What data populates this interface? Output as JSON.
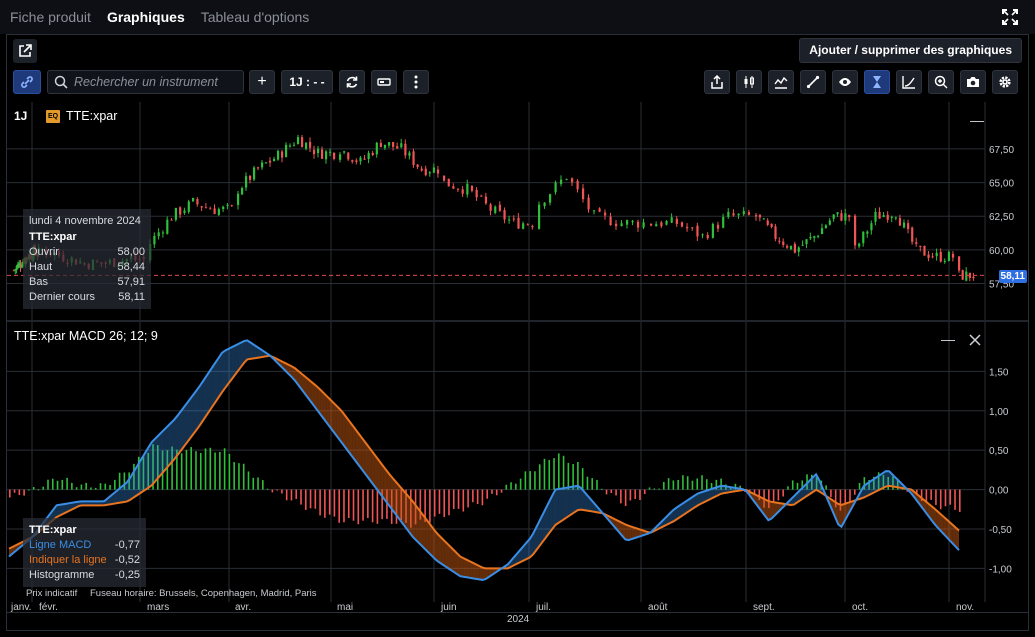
{
  "tabs": [
    {
      "label": "Fiche produit",
      "active": false
    },
    {
      "label": "Graphiques",
      "active": true
    },
    {
      "label": "Tableau d'options",
      "active": false
    }
  ],
  "header": {
    "add_remove_label": "Ajouter / supprimer des graphiques"
  },
  "toolbar": {
    "search_placeholder": "Rechercher un instrument",
    "add_label": "+",
    "interval_label": "1J : - -",
    "icons": [
      "link-icon",
      "search-icon",
      "refresh-icon",
      "chart-type-icon",
      "more-vertical-icon",
      "share-icon",
      "candles-icon",
      "indicators-icon",
      "draw-line-icon",
      "eye-icon",
      "crosshair-icon",
      "compare-icon",
      "zoom-icon",
      "camera-icon",
      "gear-icon"
    ]
  },
  "price_pane": {
    "interval": "1J",
    "badge": "EQ",
    "symbol": "TTE:xpar",
    "y_ticks": [
      "67,50",
      "65,00",
      "62,50",
      "60,00",
      "57,50"
    ],
    "last_price_tag": "58,11",
    "tooltip": {
      "date": "lundi 4 novembre 2024",
      "symbol": "TTE:xpar",
      "rows": [
        {
          "label": "Ouvrir",
          "value": "58,00"
        },
        {
          "label": "Haut",
          "value": "58,44"
        },
        {
          "label": "Bas",
          "value": "57,91"
        },
        {
          "label": "Dernier cours",
          "value": "58,11"
        }
      ]
    }
  },
  "macd_pane": {
    "title": "TTE:xpar  MACD 26; 12; 9",
    "y_ticks": [
      "1,50",
      "1,00",
      "0,50",
      "0,00",
      "-0,50",
      "-1,00"
    ],
    "tooltip": {
      "symbol": "TTE:xpar",
      "rows": [
        {
          "label": "Ligne MACD",
          "value": "-0,77",
          "color": "#3a8ee6"
        },
        {
          "label": "Indiquer la ligne",
          "value": "-0,52",
          "color": "#e8741f"
        },
        {
          "label": "Histogramme",
          "value": "-0,25",
          "color": "#d8dbe0"
        }
      ]
    },
    "colors": {
      "macd": "#3a8ee6",
      "signal": "#e8741f",
      "hist_up": "#2fbf3a",
      "hist_down": "#f05454"
    }
  },
  "x_axis": {
    "months": [
      "janv.",
      "févr.",
      "mars",
      "avr.",
      "mai",
      "juin",
      "juil.",
      "août",
      "sept.",
      "oct.",
      "nov."
    ],
    "year": "2024"
  },
  "footnote": {
    "indicative": "Prix indicatif",
    "timezone": "Fuseau horaire: Brussels, Copenhagen, Madrid, Paris"
  },
  "chart_data": [
    {
      "type": "candlestick",
      "series_name": "TTE:xpar",
      "ylim": [
        56.5,
        69.5
      ],
      "monthly_approx_close": {
        "janv.": [
          58.5,
          59.0,
          59.5,
          59.8
        ],
        "févr.": [
          60.0,
          59.5,
          59.0,
          59.0,
          59.3
        ],
        "mars": [
          60.5,
          62.5,
          63.5,
          63.0
        ],
        "avr.": [
          64.5,
          66.0,
          67.0,
          68.3,
          67.2
        ],
        "mai": [
          67.5,
          66.5,
          68.0,
          67.5,
          66.0
        ],
        "juin": [
          65.0,
          64.5,
          63.0,
          62.0
        ],
        "juil.": [
          63.5,
          65.5,
          62.5,
          62.0
        ],
        "août": [
          62.0,
          62.0,
          61.0,
          62.5
        ],
        "sept.": [
          62.5,
          61.0,
          60.0,
          61.0,
          62.5
        ],
        "oct.": [
          60.0,
          62.5,
          62.8,
          60.0,
          59.5
        ],
        "nov.": [
          58.1
        ]
      },
      "last": {
        "open": 58.0,
        "high": 58.44,
        "low": 57.91,
        "close": 58.11
      }
    },
    {
      "type": "line",
      "title": "MACD 26; 12; 9",
      "ylim": [
        -1.3,
        2.0
      ],
      "series": [
        {
          "name": "Ligne MACD",
          "values": [
            -0.85,
            -0.6,
            -0.2,
            -0.15,
            -0.15,
            0.1,
            0.6,
            0.9,
            1.3,
            1.75,
            1.9,
            1.7,
            1.4,
            1.0,
            0.6,
            0.2,
            -0.2,
            -0.6,
            -0.9,
            -1.1,
            -1.15,
            -0.95,
            -0.6,
            0.0,
            0.05,
            -0.3,
            -0.65,
            -0.55,
            -0.25,
            -0.05,
            0.05,
            0.0,
            -0.4,
            -0.1,
            0.2,
            -0.5,
            0.05,
            0.25,
            -0.05,
            -0.45,
            -0.77
          ]
        },
        {
          "name": "Indiquer la ligne",
          "values": [
            -0.75,
            -0.6,
            -0.35,
            -0.2,
            -0.2,
            -0.15,
            0.05,
            0.4,
            0.8,
            1.25,
            1.65,
            1.7,
            1.55,
            1.3,
            1.0,
            0.6,
            0.2,
            -0.15,
            -0.55,
            -0.85,
            -1.0,
            -1.0,
            -0.85,
            -0.45,
            -0.25,
            -0.3,
            -0.45,
            -0.55,
            -0.4,
            -0.2,
            -0.05,
            0.0,
            -0.15,
            -0.2,
            0.0,
            -0.2,
            -0.1,
            0.05,
            0.0,
            -0.25,
            -0.52
          ]
        },
        {
          "name": "Histogramme",
          "values": [
            -0.1,
            0.0,
            0.15,
            0.05,
            0.05,
            0.25,
            0.55,
            0.5,
            0.5,
            0.5,
            0.25,
            0.0,
            -0.15,
            -0.3,
            -0.4,
            -0.4,
            -0.4,
            -0.45,
            -0.35,
            -0.25,
            -0.15,
            0.05,
            0.25,
            0.45,
            0.3,
            0.0,
            -0.2,
            0.0,
            0.15,
            0.15,
            0.1,
            0.0,
            -0.25,
            0.1,
            0.2,
            -0.3,
            0.15,
            0.2,
            -0.05,
            -0.2,
            -0.25
          ]
        }
      ],
      "last": {
        "macd": -0.77,
        "signal": -0.52,
        "histogram": -0.25
      }
    }
  ]
}
